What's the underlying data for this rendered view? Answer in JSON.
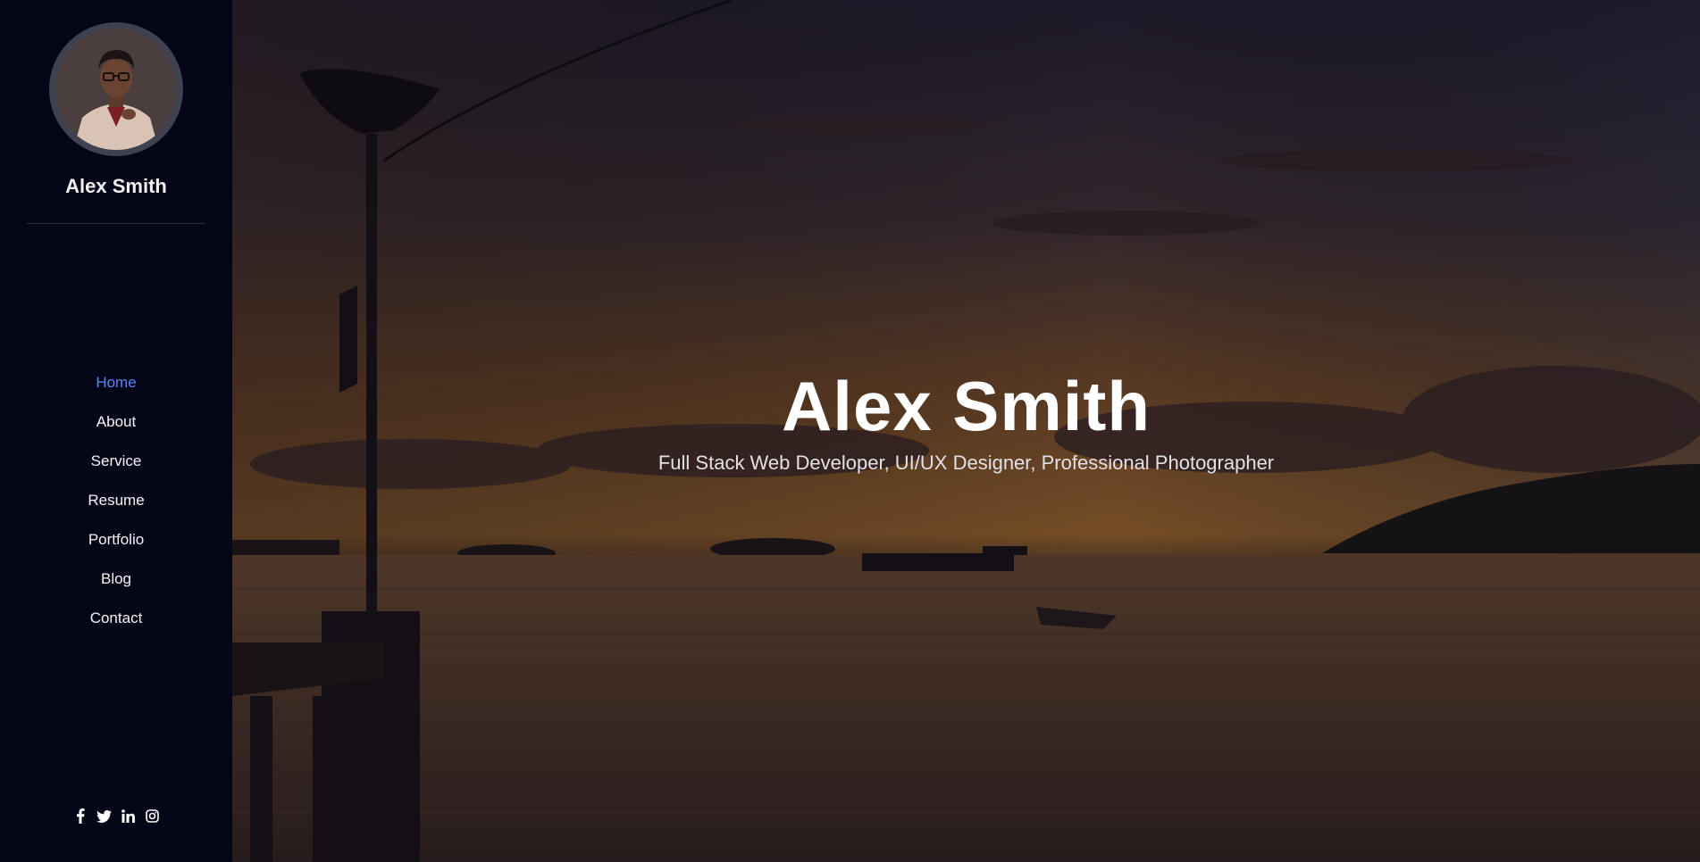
{
  "sidebar": {
    "name": "Alex Smith",
    "nav": [
      {
        "label": "Home",
        "active": true
      },
      {
        "label": "About",
        "active": false
      },
      {
        "label": "Service",
        "active": false
      },
      {
        "label": "Resume",
        "active": false
      },
      {
        "label": "Portfolio",
        "active": false
      },
      {
        "label": "Blog",
        "active": false
      },
      {
        "label": "Contact",
        "active": false
      }
    ],
    "social_icons": [
      "facebook-icon",
      "twitter-icon",
      "linkedin-icon",
      "instagram-icon"
    ]
  },
  "hero": {
    "title": "Alex Smith",
    "subtitle": "Full Stack Web Developer, UI/UX Designer, Professional Photographer"
  },
  "colors": {
    "sidebar_bg": "#050518",
    "accent": "#5a86f6",
    "text": "#ffffff"
  }
}
